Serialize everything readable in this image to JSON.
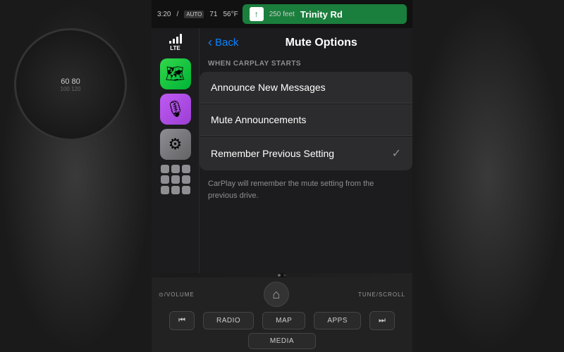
{
  "dashboard": {
    "status_bar": {
      "time": "3:20",
      "auto_label": "AUTO",
      "temp_inside": "71",
      "temp_outside": "56°F"
    },
    "nav": {
      "distance": "250 feet",
      "street": "Trinity Rd",
      "arrow": "↑"
    }
  },
  "screen": {
    "back_label": "Back",
    "title": "Mute Options",
    "section_header": "WHEN CARPLAY STARTS",
    "menu_items": [
      {
        "id": "announce",
        "label": "Announce New Messages",
        "checked": false
      },
      {
        "id": "mute",
        "label": "Mute Announcements",
        "checked": false
      },
      {
        "id": "remember",
        "label": "Remember Previous Setting",
        "checked": true
      }
    ],
    "description": "CarPlay will remember the mute setting from the previous drive.",
    "checkmark": "✓"
  },
  "sidebar": {
    "lte_label": "LTE",
    "apps": [
      {
        "id": "maps",
        "emoji": "🗺"
      },
      {
        "id": "podcasts",
        "emoji": "🎙"
      },
      {
        "id": "settings",
        "emoji": "⚙"
      }
    ]
  },
  "controls": {
    "volume_label": "⊙/VOLUME",
    "tune_label": "TUNE/SCROLL",
    "home_icon": "⌂",
    "row2": [
      {
        "id": "radio",
        "label": "RADIO"
      },
      {
        "id": "map",
        "label": "MAP"
      },
      {
        "id": "apps",
        "label": "APPS"
      }
    ],
    "row3": [
      {
        "id": "prev",
        "label": "⏮"
      },
      {
        "id": "media",
        "label": "MEDIA"
      },
      {
        "id": "next",
        "label": "⏭"
      }
    ]
  }
}
